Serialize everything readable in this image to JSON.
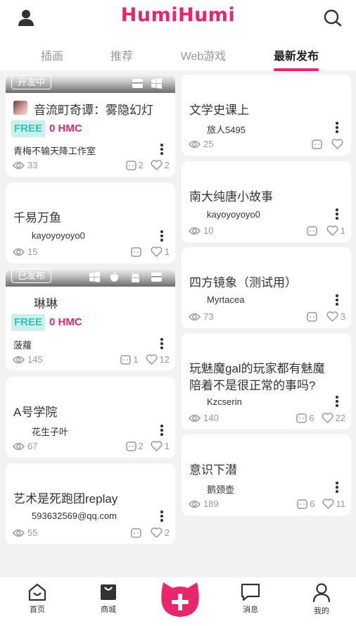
{
  "app": {
    "title": "HumiHumi"
  },
  "colors": {
    "brand": "#e8256d",
    "free_bg": "#c9f0ec",
    "free_text": "#32c2b6",
    "meta": "#999999"
  },
  "tabs": [
    {
      "label": "插画",
      "active": false
    },
    {
      "label": "推荐",
      "active": false
    },
    {
      "label": "Web游戏",
      "active": false
    },
    {
      "label": "最新发布",
      "active": true
    }
  ],
  "icons": {
    "user": "user-icon",
    "search": "search-icon",
    "views": "eye-icon",
    "comments": "comment-icon",
    "likes": "heart-icon"
  },
  "left_cards": [
    {
      "ribbon": "开发中",
      "platforms": [
        "web-icon",
        "windows-icon"
      ],
      "title": "音流町奇谭：雾隐幻灯",
      "free": "FREE",
      "price": "0 HMC",
      "author": "青梅不输天降工作室",
      "views": "33",
      "comments": "2",
      "likes": "2"
    },
    {
      "title": "千易万鱼",
      "author": "kayoyoyoyo0",
      "views": "15",
      "comments": "",
      "likes": "1"
    },
    {
      "ribbon": "已发布",
      "platforms": [
        "windows-icon",
        "apple-icon",
        "android-icon",
        "web-icon"
      ],
      "title": "琳琳",
      "free": "FREE",
      "price": "0 HMC",
      "author": "菠蘿",
      "views": "145",
      "comments": "1",
      "likes": "12"
    },
    {
      "title": "A号学院",
      "author": "花生子叶",
      "views": "67",
      "comments": "2",
      "likes": "1"
    },
    {
      "title": "艺术是死跑团replay",
      "author": "593632569@qq.com",
      "views": "55",
      "comments": "",
      "likes": "2"
    }
  ],
  "right_cards": [
    {
      "title": "文学史课上",
      "author": "旅人5495",
      "views": "25",
      "comments": "",
      "likes": ""
    },
    {
      "title": "南大纯唐小故事",
      "author": "kayoyoyoyo0",
      "views": "10",
      "comments": "",
      "likes": "1"
    },
    {
      "title": "四方镜象（测试用）",
      "author": "Myrtacea",
      "views": "73",
      "comments": "",
      "likes": "3"
    },
    {
      "title": "玩魅魔gal的玩家都有魅魔",
      "title2": "陪着不是很正常的事吗?",
      "author": "Kzcserin",
      "views": "140",
      "comments": "6",
      "likes": "22"
    },
    {
      "title": "意识下潜",
      "author": "鹅颈壶",
      "views": "189",
      "comments": "6",
      "likes": "11"
    }
  ],
  "bottom_nav": [
    {
      "label": "首页",
      "icon": "home-icon"
    },
    {
      "label": "商城",
      "icon": "shop-bag-icon"
    },
    {
      "label": "",
      "icon": "add-cat-icon"
    },
    {
      "label": "消息",
      "icon": "message-icon"
    },
    {
      "label": "我的",
      "icon": "profile-icon"
    }
  ]
}
